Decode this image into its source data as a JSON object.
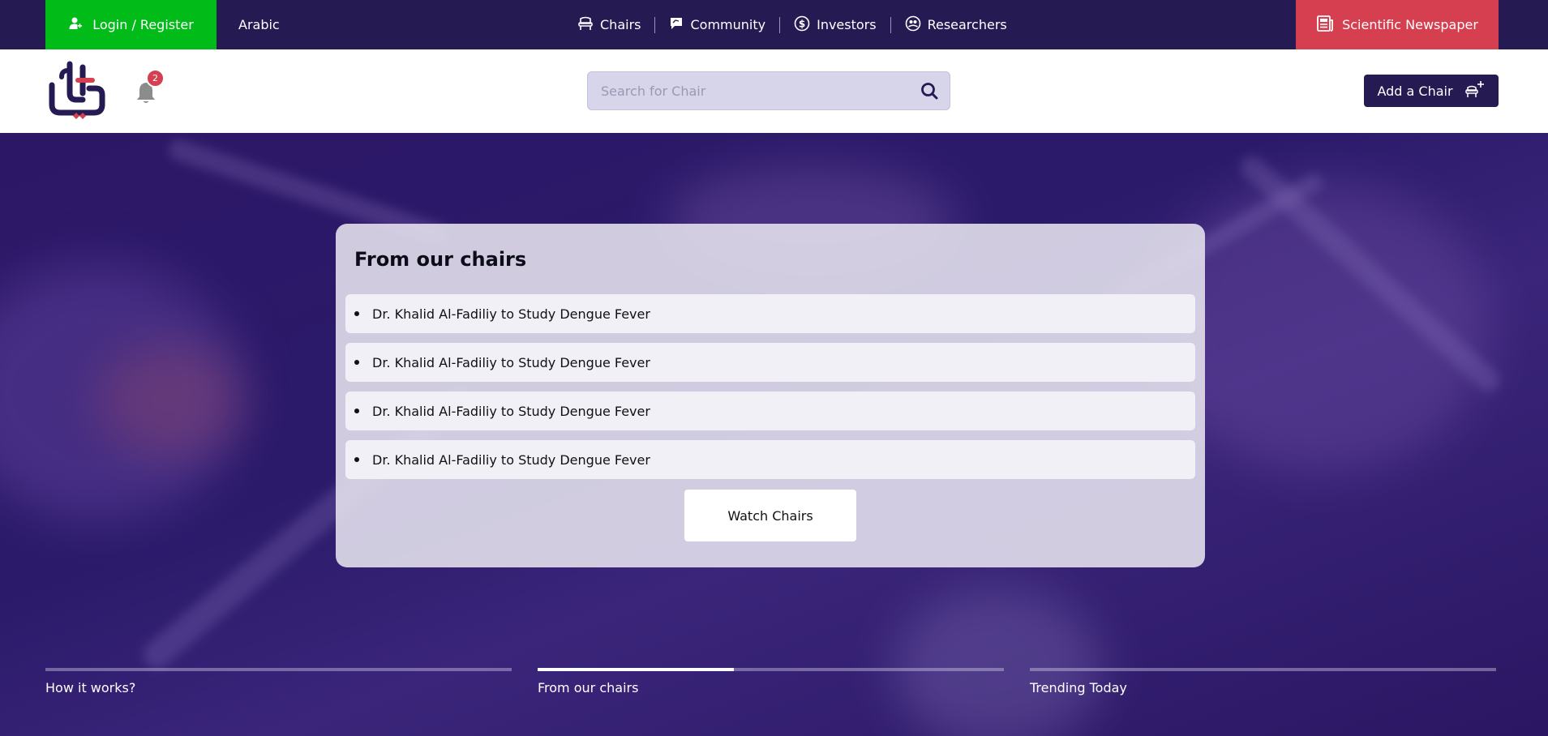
{
  "topbar": {
    "login_label": "Login / Register",
    "language_label": "Arabic",
    "nav": [
      {
        "label": "Chairs",
        "icon": "chair-icon"
      },
      {
        "label": "Community",
        "icon": "chat-icon"
      },
      {
        "label": "Investors",
        "icon": "dollar-coin-icon"
      },
      {
        "label": "Researchers",
        "icon": "researchers-icon"
      }
    ],
    "newspaper_label": "Scientific Newspaper"
  },
  "header": {
    "notification_count": "2",
    "search_placeholder": "Search for Chair",
    "add_chair_label": "Add a Chair"
  },
  "card": {
    "title": "From our chairs",
    "items": [
      "Dr. Khalid Al-Fadiliy to Study Dengue Fever",
      "Dr. Khalid Al-Fadiliy to Study Dengue Fever",
      "Dr. Khalid Al-Fadiliy to Study Dengue Fever",
      "Dr. Khalid Al-Fadiliy to Study Dengue Fever"
    ],
    "button_label": "Watch Chairs"
  },
  "slides": [
    {
      "label": "How it works?",
      "progress": 0
    },
    {
      "label": "From our chairs",
      "progress": 0.42
    },
    {
      "label": "Trending Today",
      "progress": 0
    }
  ],
  "colors": {
    "topbar": "#261a52",
    "login": "#00bb18",
    "newspaper": "#d63f50",
    "badge": "#d63f50",
    "primary": "#261a52"
  }
}
